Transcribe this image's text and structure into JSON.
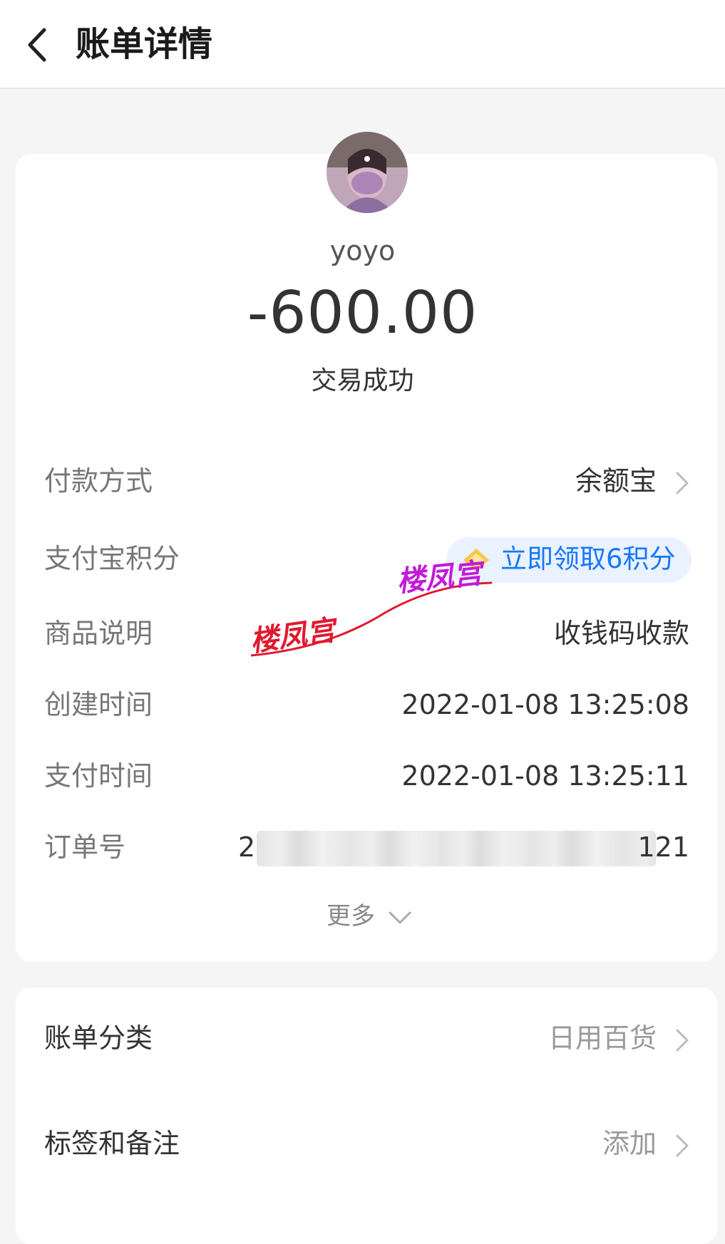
{
  "header": {
    "title": "账单详情"
  },
  "counterparty": {
    "name": "yoyo"
  },
  "transaction": {
    "amount": "-600.00",
    "status": "交易成功"
  },
  "details": {
    "payment_method_label": "付款方式",
    "payment_method_value": "余额宝",
    "points_label": "支付宝积分",
    "points_action": "立即领取6积分",
    "description_label": "商品说明",
    "description_value": "收钱码收款",
    "created_label": "创建时间",
    "created_value": "2022-01-08 13:25:08",
    "paid_label": "支付时间",
    "paid_value": "2022-01-08 13:25:11",
    "order_label": "订单号",
    "order_prefix": "2",
    "order_suffix": "121",
    "more_label": "更多"
  },
  "extras": {
    "category_label": "账单分类",
    "category_value": "日用百货",
    "tags_label": "标签和备注",
    "tags_value": "添加"
  },
  "watermark": {
    "text": "楼凤宫"
  },
  "colors": {
    "accent": "#1677ff",
    "watermark": "#e0192f"
  }
}
